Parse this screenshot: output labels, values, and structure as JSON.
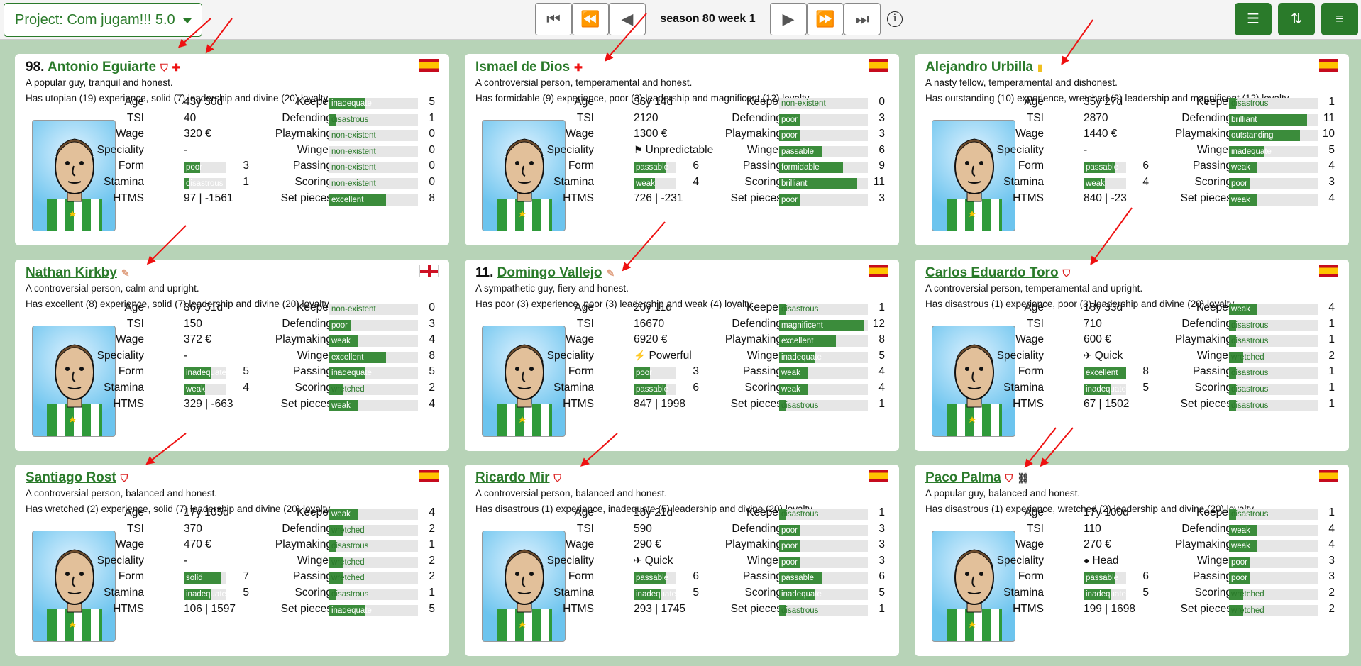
{
  "toolbar": {
    "project_label": "Project: Com jugam!!! 5.0",
    "season": "season 80 week 1",
    "nav": [
      "⏮",
      "⏪",
      "◀",
      "▶",
      "⏩",
      "⏭"
    ],
    "icons": [
      "filter-icon",
      "sort-icon",
      "menu-icon"
    ],
    "accent": "#2a7a2a"
  },
  "labels": {
    "age": "Age",
    "tsi": "TSI",
    "wage": "Wage",
    "speciality": "Speciality",
    "form": "Form",
    "stamina": "Stamina",
    "htms": "HTMS",
    "keeper": "Keeper",
    "defending": "Defending",
    "playmaking": "Playmaking",
    "winger": "Winger",
    "passing": "Passing",
    "scoring": "Scoring",
    "set_pieces": "Set pieces"
  },
  "players": [
    {
      "num": "98.",
      "name": "Antonio Eguiarte",
      "flag": "es",
      "status": [
        "shield",
        "cross"
      ],
      "desc1": "A popular guy, tranquil and honest.",
      "desc2": "Has utopian (19) experience, solid (7) leadership and divine (20) loyalty.",
      "age": "43y 30d",
      "tsi": "40",
      "wage": "320 €",
      "speciality": "-",
      "spec_icon": "",
      "form": {
        "text": "poor",
        "lvl": "3"
      },
      "stamina": {
        "text": "disastrous",
        "lvl": "1"
      },
      "htms": "97 | -1561",
      "skills": [
        {
          "text": "inadequate",
          "lvl": "5"
        },
        {
          "text": "disastrous",
          "lvl": "1"
        },
        {
          "text": "non-existent",
          "lvl": "0"
        },
        {
          "text": "non-existent",
          "lvl": "0"
        },
        {
          "text": "non-existent",
          "lvl": "0"
        },
        {
          "text": "non-existent",
          "lvl": "0"
        },
        {
          "text": "excellent",
          "lvl": "8"
        }
      ]
    },
    {
      "num": "",
      "name": "Ismael de Dios",
      "flag": "es",
      "status": [
        "cross"
      ],
      "desc1": "A controversial person, temperamental and honest.",
      "desc2": "Has formidable (9) experience, poor (3) leadership and magnificent (12) loyalty.",
      "age": "36y 14d",
      "tsi": "2120",
      "wage": "1300 €",
      "speciality": "Unpredictable",
      "spec_icon": "⚑",
      "form": {
        "text": "passable",
        "lvl": "6"
      },
      "stamina": {
        "text": "weak",
        "lvl": "4"
      },
      "htms": "726 | -231",
      "skills": [
        {
          "text": "non-existent",
          "lvl": "0"
        },
        {
          "text": "poor",
          "lvl": "3"
        },
        {
          "text": "poor",
          "lvl": "3"
        },
        {
          "text": "passable",
          "lvl": "6"
        },
        {
          "text": "formidable",
          "lvl": "9"
        },
        {
          "text": "brilliant",
          "lvl": "11"
        },
        {
          "text": "poor",
          "lvl": "3"
        }
      ]
    },
    {
      "num": "",
      "name": "Alejandro Urbilla",
      "flag": "es",
      "status": [
        "yellow"
      ],
      "desc1": "A nasty fellow, temperamental and dishonest.",
      "desc2": "Has outstanding (10) experience, wretched (2) leadership and magnificent (12) loyalty.",
      "age": "35y 27d",
      "tsi": "2870",
      "wage": "1440 €",
      "speciality": "-",
      "spec_icon": "",
      "form": {
        "text": "passable",
        "lvl": "6"
      },
      "stamina": {
        "text": "weak",
        "lvl": "4"
      },
      "htms": "840 | -23",
      "skills": [
        {
          "text": "disastrous",
          "lvl": "1"
        },
        {
          "text": "brilliant",
          "lvl": "11"
        },
        {
          "text": "outstanding",
          "lvl": "10"
        },
        {
          "text": "inadequate",
          "lvl": "5"
        },
        {
          "text": "weak",
          "lvl": "4"
        },
        {
          "text": "poor",
          "lvl": "3"
        },
        {
          "text": "weak",
          "lvl": "4"
        }
      ]
    },
    {
      "num": "",
      "name": "Nathan Kirkby",
      "flag": "en",
      "status": [
        "plaster"
      ],
      "desc1": "A controversial person, calm and upright.",
      "desc2": "Has excellent (8) experience, solid (7) leadership and divine (20) loyalty.",
      "age": "36y 51d",
      "tsi": "150",
      "wage": "372 €",
      "speciality": "-",
      "spec_icon": "",
      "form": {
        "text": "inadequate",
        "lvl": "5"
      },
      "stamina": {
        "text": "weak",
        "lvl": "4"
      },
      "htms": "329 | -663",
      "skills": [
        {
          "text": "non-existent",
          "lvl": "0"
        },
        {
          "text": "poor",
          "lvl": "3"
        },
        {
          "text": "weak",
          "lvl": "4"
        },
        {
          "text": "excellent",
          "lvl": "8"
        },
        {
          "text": "inadequate",
          "lvl": "5"
        },
        {
          "text": "wretched",
          "lvl": "2"
        },
        {
          "text": "weak",
          "lvl": "4"
        }
      ]
    },
    {
      "num": "11.",
      "name": "Domingo Vallejo",
      "flag": "es",
      "status": [
        "plaster"
      ],
      "desc1": "A sympathetic guy, fiery and honest.",
      "desc2": "Has poor (3) experience, poor (3) leadership and weak (4) loyalty.",
      "age": "20y 11d",
      "tsi": "16670",
      "wage": "6920 €",
      "speciality": "Powerful",
      "spec_icon": "⚡",
      "form": {
        "text": "poor",
        "lvl": "3"
      },
      "stamina": {
        "text": "passable",
        "lvl": "6"
      },
      "htms": "847 | 1998",
      "skills": [
        {
          "text": "disastrous",
          "lvl": "1"
        },
        {
          "text": "magnificent",
          "lvl": "12"
        },
        {
          "text": "excellent",
          "lvl": "8"
        },
        {
          "text": "inadequate",
          "lvl": "5"
        },
        {
          "text": "weak",
          "lvl": "4"
        },
        {
          "text": "weak",
          "lvl": "4"
        },
        {
          "text": "disastrous",
          "lvl": "1"
        }
      ]
    },
    {
      "num": "",
      "name": "Carlos Eduardo Toro",
      "flag": "es",
      "status": [
        "shield"
      ],
      "desc1": "A controversial person, temperamental and upright.",
      "desc2": "Has disastrous (1) experience, poor (3) leadership and divine (20) loyalty.",
      "age": "18y 33d",
      "tsi": "710",
      "wage": "600 €",
      "speciality": "Quick",
      "spec_icon": "✈",
      "form": {
        "text": "excellent",
        "lvl": "8"
      },
      "stamina": {
        "text": "inadequate",
        "lvl": "5"
      },
      "htms": "67 | 1502",
      "skills": [
        {
          "text": "weak",
          "lvl": "4"
        },
        {
          "text": "disastrous",
          "lvl": "1"
        },
        {
          "text": "disastrous",
          "lvl": "1"
        },
        {
          "text": "wretched",
          "lvl": "2"
        },
        {
          "text": "disastrous",
          "lvl": "1"
        },
        {
          "text": "disastrous",
          "lvl": "1"
        },
        {
          "text": "disastrous",
          "lvl": "1"
        }
      ]
    },
    {
      "num": "",
      "name": "Santiago Rost",
      "flag": "es",
      "status": [
        "shield"
      ],
      "desc1": "A controversial person, balanced and honest.",
      "desc2": "Has wretched (2) experience, solid (7) leadership and divine (20) loyalty.",
      "age": "17y 105d",
      "tsi": "370",
      "wage": "470 €",
      "speciality": "-",
      "spec_icon": "",
      "form": {
        "text": "solid",
        "lvl": "7"
      },
      "stamina": {
        "text": "inadequate",
        "lvl": "5"
      },
      "htms": "106 | 1597",
      "skills": [
        {
          "text": "weak",
          "lvl": "4"
        },
        {
          "text": "wretched",
          "lvl": "2"
        },
        {
          "text": "disastrous",
          "lvl": "1"
        },
        {
          "text": "wretched",
          "lvl": "2"
        },
        {
          "text": "wretched",
          "lvl": "2"
        },
        {
          "text": "disastrous",
          "lvl": "1"
        },
        {
          "text": "inadequate",
          "lvl": "5"
        }
      ]
    },
    {
      "num": "",
      "name": "Ricardo Mir",
      "flag": "es",
      "status": [
        "shield"
      ],
      "desc1": "A controversial person, balanced and honest.",
      "desc2": "Has disastrous (1) experience, inadequate (5) leadership and divine (20) loyalty.",
      "age": "18y 21d",
      "tsi": "590",
      "wage": "290 €",
      "speciality": "Quick",
      "spec_icon": "✈",
      "form": {
        "text": "passable",
        "lvl": "6"
      },
      "stamina": {
        "text": "inadequate",
        "lvl": "5"
      },
      "htms": "293 | 1745",
      "skills": [
        {
          "text": "disastrous",
          "lvl": "1"
        },
        {
          "text": "poor",
          "lvl": "3"
        },
        {
          "text": "poor",
          "lvl": "3"
        },
        {
          "text": "poor",
          "lvl": "3"
        },
        {
          "text": "passable",
          "lvl": "6"
        },
        {
          "text": "inadequate",
          "lvl": "5"
        },
        {
          "text": "disastrous",
          "lvl": "1"
        }
      ]
    },
    {
      "num": "",
      "name": "Paco Palma",
      "flag": "es",
      "status": [
        "shield",
        "link"
      ],
      "desc1": "A popular guy, balanced and honest.",
      "desc2": "Has disastrous (1) experience, wretched (2) leadership and divine (20) loyalty.",
      "age": "17y 100d",
      "tsi": "110",
      "wage": "270 €",
      "speciality": "Head",
      "spec_icon": "●",
      "form": {
        "text": "passable",
        "lvl": "6"
      },
      "stamina": {
        "text": "inadequate",
        "lvl": "5"
      },
      "htms": "199 | 1698",
      "skills": [
        {
          "text": "disastrous",
          "lvl": "1"
        },
        {
          "text": "weak",
          "lvl": "4"
        },
        {
          "text": "weak",
          "lvl": "4"
        },
        {
          "text": "poor",
          "lvl": "3"
        },
        {
          "text": "poor",
          "lvl": "3"
        },
        {
          "text": "wretched",
          "lvl": "2"
        },
        {
          "text": "wretched",
          "lvl": "2"
        }
      ]
    }
  ]
}
